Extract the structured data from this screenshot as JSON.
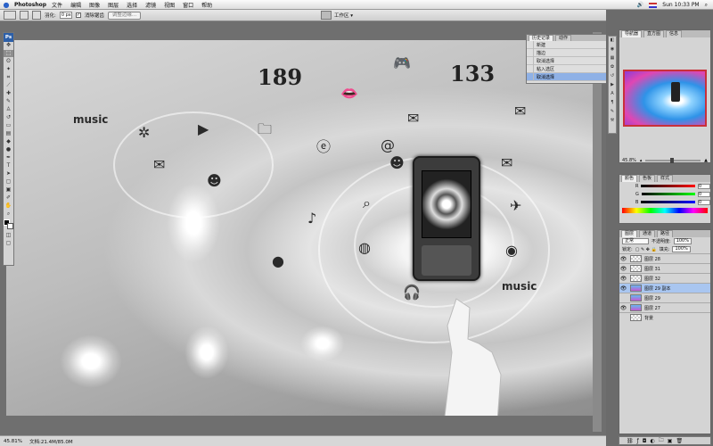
{
  "menubar": {
    "app_name": "Photoshop",
    "items": [
      "文件",
      "编辑",
      "图像",
      "图层",
      "选择",
      "滤镜",
      "视图",
      "窗口",
      "帮助"
    ],
    "clock": "Sun 10:33 PM"
  },
  "options": {
    "feather_label": "羽化:",
    "feather_value": "0 px",
    "antialias_label": "消除锯齿",
    "refine_button": "调整边缘...",
    "workspace_label": "工作区 ▾"
  },
  "history": {
    "tabs": [
      "历史记录",
      "动作"
    ],
    "items": [
      "新建",
      "描边",
      "取消选择",
      "粘入选区",
      "取消选择"
    ],
    "selected_index": 4
  },
  "navigator": {
    "tabs": [
      "导航器",
      "直方图",
      "信息"
    ],
    "zoom": "45.8%"
  },
  "color": {
    "tabs": [
      "颜色",
      "色板",
      "样式"
    ],
    "channels": [
      {
        "name": "R",
        "value": "0"
      },
      {
        "name": "G",
        "value": "0"
      },
      {
        "name": "B",
        "value": "0"
      }
    ]
  },
  "layers": {
    "tabs": [
      "图层",
      "通道",
      "路径"
    ],
    "blend_mode": "正常",
    "opacity_label": "不透明度:",
    "opacity": "100%",
    "lock_label": "锁定:",
    "fill_label": "填充:",
    "fill": "100%",
    "items": [
      {
        "name": "图层 28",
        "visible": true
      },
      {
        "name": "图层 31",
        "visible": true
      },
      {
        "name": "图层 32",
        "visible": true
      },
      {
        "name": "图层 29 副本",
        "visible": true
      },
      {
        "name": "图层 29",
        "visible": false
      },
      {
        "name": "图层 27",
        "visible": true
      },
      {
        "name": "背景",
        "visible": false
      }
    ],
    "selected_index": 3
  },
  "status": {
    "zoom": "45.81%",
    "doc": "文档:21.4M/85.0M"
  },
  "canvas": {
    "badge_a": "189",
    "badge_b": "133",
    "music_a": "music",
    "music_b": "music"
  },
  "colors": {
    "selection": "#8fb1e6",
    "nav_border": "#c9303a",
    "ps_blue": "#2c5fa8"
  }
}
